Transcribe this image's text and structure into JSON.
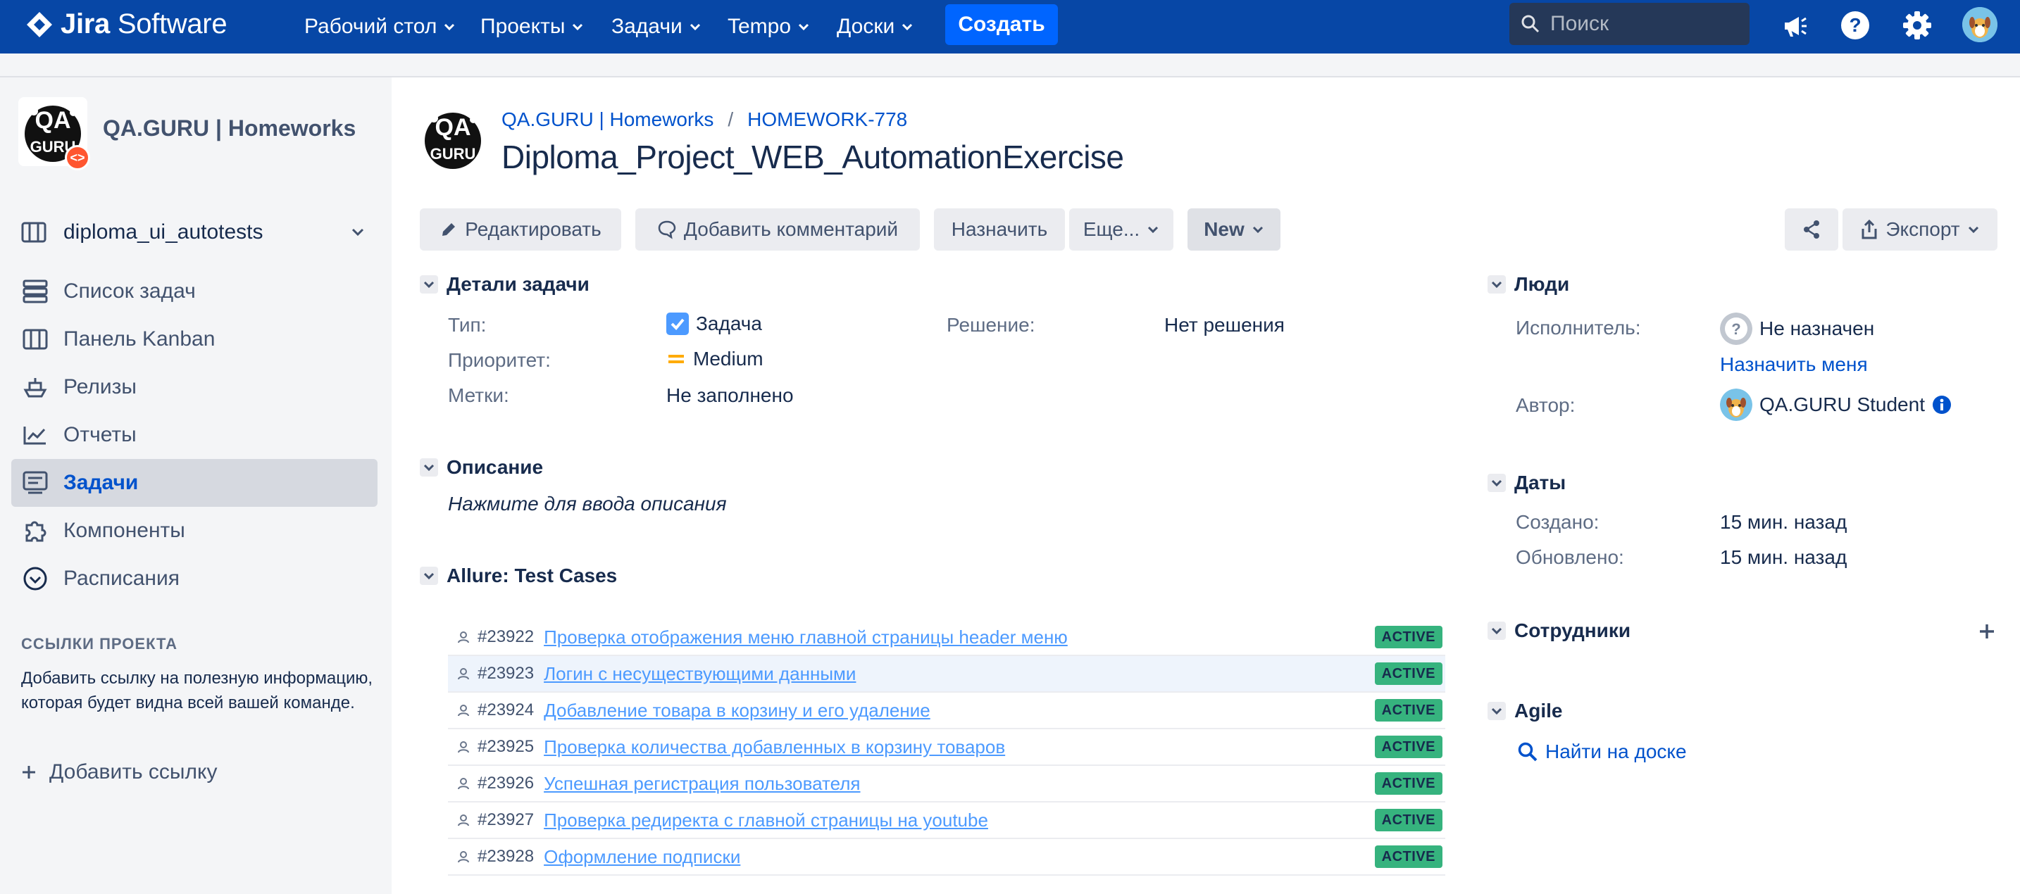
{
  "header": {
    "logo_text_bold": "Jira",
    "logo_text_light": "Software",
    "nav": [
      {
        "label": "Рабочий стол"
      },
      {
        "label": "Проекты"
      },
      {
        "label": "Задачи"
      },
      {
        "label": "Tempo"
      },
      {
        "label": "Доски"
      }
    ],
    "create_label": "Создать",
    "search_placeholder": "Поиск",
    "icons": [
      "megaphone-icon",
      "help-icon",
      "settings-icon",
      "user-avatar"
    ]
  },
  "sidebar": {
    "project_name": "QA.GURU | Homeworks",
    "board_name": "diploma_ui_autotests",
    "items": [
      {
        "label": "Список задач",
        "icon": "backlog-icon"
      },
      {
        "label": "Панель Kanban",
        "icon": "kanban-icon"
      },
      {
        "label": "Релизы",
        "icon": "ship-icon"
      },
      {
        "label": "Отчеты",
        "icon": "chart-icon"
      },
      {
        "label": "Задачи",
        "icon": "issues-icon",
        "active": true
      },
      {
        "label": "Компоненты",
        "icon": "puzzle-icon"
      },
      {
        "label": "Расписания",
        "icon": "schedule-icon"
      }
    ],
    "links_section_title": "ССЫЛКИ ПРОЕКТА",
    "links_help": "Добавить ссылку на полезную информацию, которая будет видна всей вашей команде.",
    "add_link_label": "Добавить ссылку"
  },
  "issue": {
    "breadcrumb_project": "QA.GURU | Homeworks",
    "breadcrumb_key": "HOMEWORK-778",
    "title": "Diploma_Project_WEB_AutomationExercise",
    "toolbar": {
      "edit": "Редактировать",
      "comment": "Добавить комментарий",
      "assign": "Назначить",
      "more": "Еще...",
      "status": "New",
      "export": "Экспорт"
    },
    "details": {
      "title": "Детали задачи",
      "type_label": "Тип:",
      "type_value": "Задача",
      "priority_label": "Приоритет:",
      "priority_value": "Medium",
      "labels_label": "Метки:",
      "labels_value": "Не заполнено",
      "resolution_label": "Решение:",
      "resolution_value": "Нет решения"
    },
    "description": {
      "title": "Описание",
      "placeholder": "Нажмите для ввода описания"
    },
    "allure": {
      "title": "Allure: Test Cases",
      "cases": [
        {
          "id": "#23922",
          "name": "Проверка отображения меню главной страницы header меню",
          "status": "ACTIVE"
        },
        {
          "id": "#23923",
          "name": "Логин с несуществующими данными",
          "status": "ACTIVE"
        },
        {
          "id": "#23924",
          "name": "Добавление товара в корзину и его удаление",
          "status": "ACTIVE"
        },
        {
          "id": "#23925",
          "name": "Проверка количества добавленных в корзину товаров",
          "status": "ACTIVE"
        },
        {
          "id": "#23926",
          "name": "Успешная регистрация пользователя",
          "status": "ACTIVE"
        },
        {
          "id": "#23927",
          "name": "Проверка редиректа с главной страницы на youtube",
          "status": "ACTIVE"
        },
        {
          "id": "#23928",
          "name": "Оформление подписки",
          "status": "ACTIVE"
        }
      ]
    }
  },
  "right": {
    "people": {
      "title": "Люди",
      "assignee_label": "Исполнитель:",
      "assignee_value": "Не назначен",
      "assign_me": "Назначить меня",
      "reporter_label": "Автор:",
      "reporter_value": "QA.GURU Student"
    },
    "dates": {
      "title": "Даты",
      "created_label": "Создано:",
      "created_value": "15 мин. назад",
      "updated_label": "Обновлено:",
      "updated_value": "15 мин. назад"
    },
    "staff": {
      "title": "Сотрудники"
    },
    "agile": {
      "title": "Agile",
      "find_on_board": "Найти на доске"
    }
  },
  "colors": {
    "header_bg": "#0747a6",
    "create_button": "#0065ff",
    "link": "#0052cc",
    "status_active": "#36b37e",
    "sidebar_bg": "#f4f5f7"
  }
}
